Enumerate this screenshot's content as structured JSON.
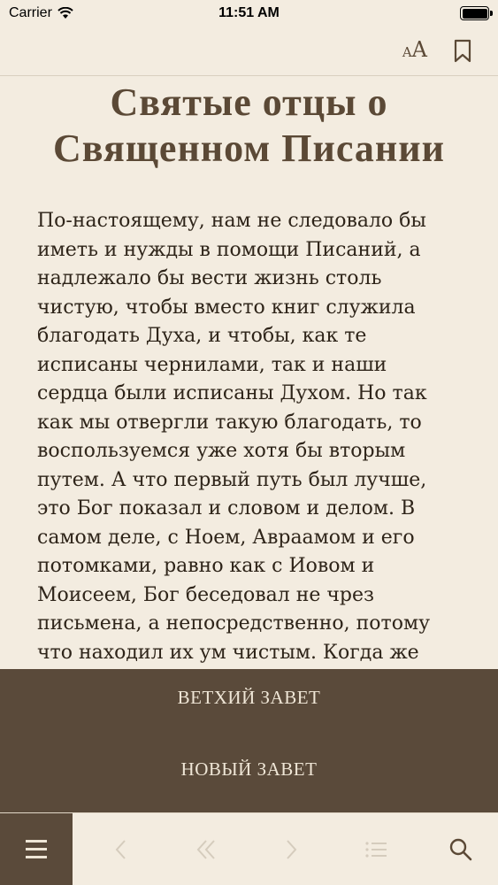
{
  "status_bar": {
    "carrier": "Carrier",
    "time": "11:51 AM"
  },
  "toolbar": {
    "font_small": "A",
    "font_big": "A"
  },
  "article": {
    "title": "Святые отцы о Священном Писании",
    "text": "По-настоящему, нам не следовало бы иметь и нужды в помощи Писаний, а надлежало бы вести жизнь столь чистую, чтобы вместо книг служила благодать Духа, и чтобы, как те исписаны чернилами, так и наши сердца были исписаны Духом. Но так как мы отвергли такую благодать, то воспользуемся уже хотя бы вторым путем. А что первый путь был лучше, это Бог показал и словом и делом. В самом деле, с Ноем, Авраамом и его потомками, равно как с Иовом и Моисеем, Бог беседовал не чрез письмена, а непосредственно, потому что находил их ум чистым. Когда же"
  },
  "menu": {
    "items": [
      {
        "label": "ВЕТХИЙ ЗАВЕТ"
      },
      {
        "label": "НОВЫЙ ЗАВЕТ"
      }
    ]
  },
  "colors": {
    "background": "#f3ece0",
    "panel": "#5a4a3a",
    "accent": "#5b4936",
    "disabled": "#d5ccbd"
  }
}
